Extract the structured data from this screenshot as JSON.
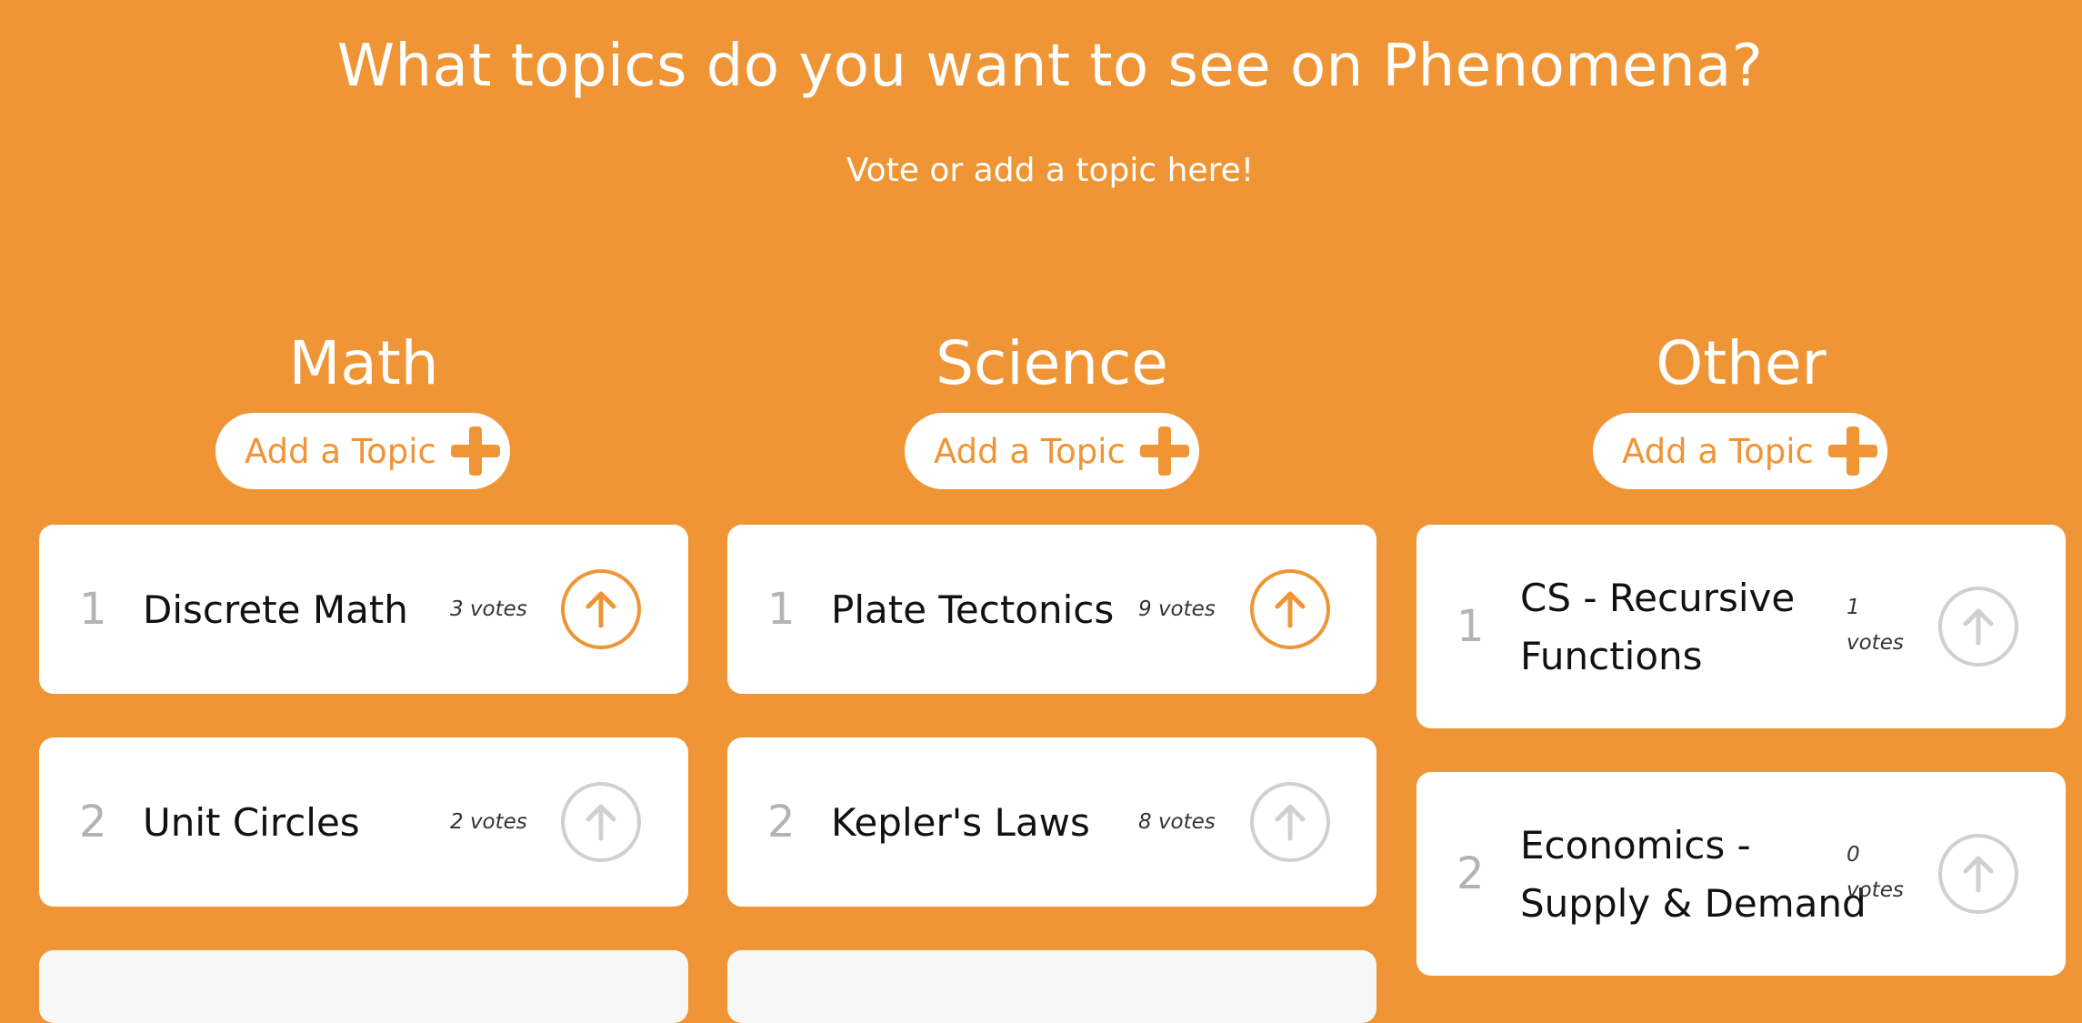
{
  "header": {
    "title": "What topics do you want to see on Phenomena?",
    "subtitle": "Vote or add a topic here!"
  },
  "colors": {
    "accent": "#ef9535",
    "inactive": "#d0d0d0"
  },
  "add_topic_label": "Add a Topic",
  "columns": [
    {
      "heading": "Math",
      "topics": [
        {
          "rank": "1",
          "name": "Discrete Math",
          "votes": "3 votes",
          "upvoted": true
        },
        {
          "rank": "2",
          "name": "Unit Circles",
          "votes": "2 votes",
          "upvoted": false
        }
      ]
    },
    {
      "heading": "Science",
      "topics": [
        {
          "rank": "1",
          "name": "Plate Tectonics",
          "votes": "9 votes",
          "upvoted": true
        },
        {
          "rank": "2",
          "name": "Kepler's Laws",
          "votes": "8 votes",
          "upvoted": false
        }
      ]
    },
    {
      "heading": "Other",
      "topics": [
        {
          "rank": "1",
          "name_line1": "CS - Recursive",
          "name_line2": "Functions",
          "votes_line1": "1",
          "votes_line2": "votes",
          "upvoted": false
        },
        {
          "rank": "2",
          "name_line1": "Economics -",
          "name_line2": "Supply & Demand",
          "votes_line1": "0",
          "votes_line2": "votes",
          "upvoted": false
        }
      ]
    }
  ]
}
